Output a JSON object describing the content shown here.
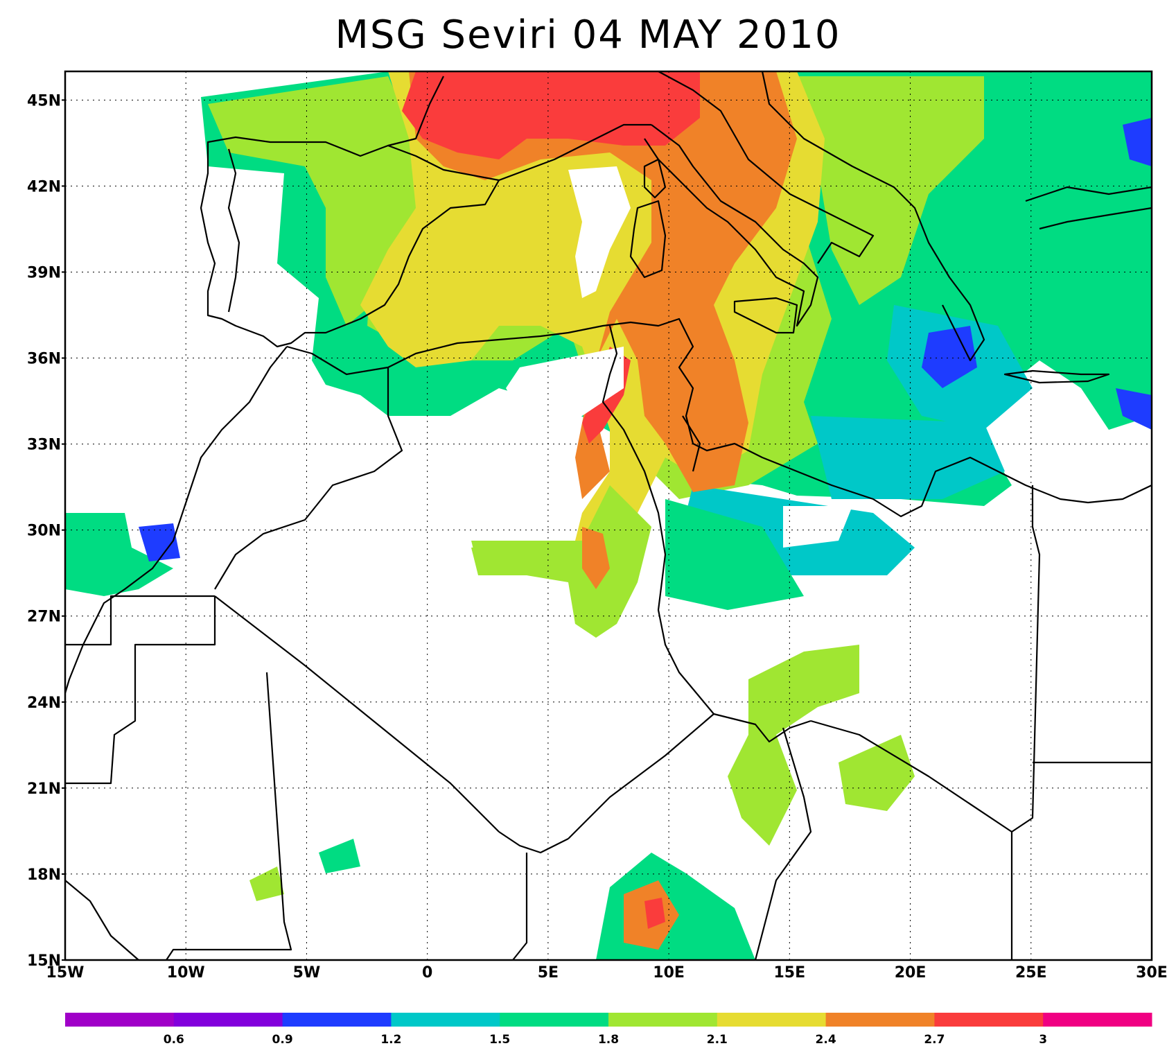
{
  "title": "MSG Seviri  04 MAY 2010",
  "map": {
    "lon_range": [
      -15,
      30
    ],
    "lat_range": [
      15,
      46
    ],
    "lat_ticks": [
      "15N",
      "18N",
      "21N",
      "24N",
      "27N",
      "30N",
      "33N",
      "36N",
      "39N",
      "42N",
      "45N"
    ],
    "lon_ticks": [
      "15W",
      "10W",
      "5W",
      "0",
      "5E",
      "10E",
      "15E",
      "20E",
      "25E",
      "30E"
    ],
    "grid_style": "dotted",
    "background": "#ffffff",
    "boundaries_color": "#000000"
  },
  "colorbar": {
    "colors": [
      "#a000c8",
      "#8200dc",
      "#1e3cff",
      "#00c8c8",
      "#00dc82",
      "#a0e632",
      "#e6dc32",
      "#f08228",
      "#fa3c3c",
      "#f00082"
    ],
    "labels": [
      "0.6",
      "0.9",
      "1.2",
      "1.5",
      "1.8",
      "2.1",
      "2.4",
      "2.7",
      "3"
    ]
  }
}
